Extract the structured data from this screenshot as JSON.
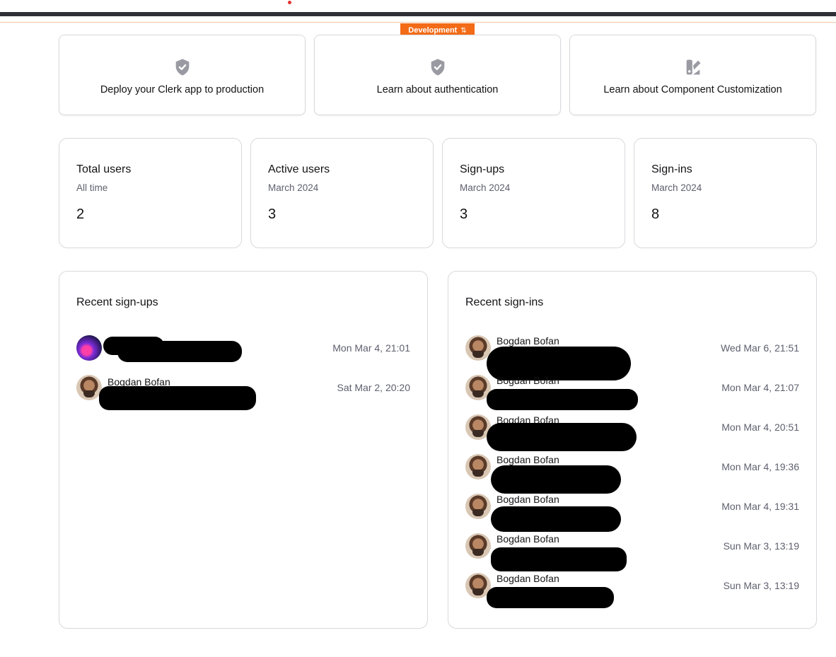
{
  "env_badge": {
    "label": "Development",
    "icon": "swap-icon"
  },
  "action_cards": [
    {
      "label": "Deploy your Clerk app to production",
      "icon": "shield-check-icon"
    },
    {
      "label": "Learn about authentication",
      "icon": "shield-check-icon"
    },
    {
      "label": "Learn about Component Customization",
      "icon": "palette-icon"
    }
  ],
  "stats": [
    {
      "title": "Total users",
      "subtitle": "All time",
      "value": "2"
    },
    {
      "title": "Active users",
      "subtitle": "March 2024",
      "value": "3"
    },
    {
      "title": "Sign-ups",
      "subtitle": "March 2024",
      "value": "3"
    },
    {
      "title": "Sign-ins",
      "subtitle": "March 2024",
      "value": "8"
    }
  ],
  "recent_signups": {
    "title": "Recent sign-ups",
    "rows": [
      {
        "name": "",
        "date": "Mon Mar 4, 21:01"
      },
      {
        "name": "Bogdan Bofan",
        "date": "Sat Mar 2, 20:20"
      }
    ]
  },
  "recent_signins": {
    "title": "Recent sign-ins",
    "rows": [
      {
        "name": "Bogdan Bofan",
        "date": "Wed Mar 6, 21:51"
      },
      {
        "name": "Bogdan Bofan",
        "date": "Mon Mar 4, 21:07"
      },
      {
        "name": "Bogdan Bofan",
        "date": "Mon Mar 4, 20:51"
      },
      {
        "name": "Bogdan Bofan",
        "date": "Mon Mar 4, 19:36"
      },
      {
        "name": "Bogdan Bofan",
        "date": "Mon Mar 4, 19:31"
      },
      {
        "name": "Bogdan Bofan",
        "date": "Sun Mar 3, 13:19"
      },
      {
        "name": "Bogdan Bofan",
        "date": "Sun Mar 3, 13:19"
      }
    ]
  }
}
